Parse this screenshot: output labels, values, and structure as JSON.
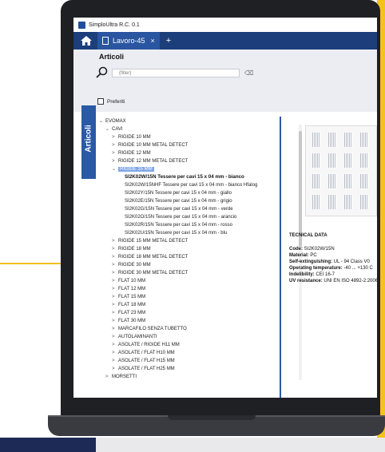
{
  "window": {
    "title": "SimploUltra R.C. 0.1"
  },
  "tabs": {
    "items": [
      {
        "label": "Lavoro-45"
      }
    ],
    "add_label": "+",
    "close_label": "×"
  },
  "panel": {
    "title": "Articoli",
    "search_placeholder": "(filter)",
    "favorites_label": "Preferiti",
    "side_tab_label": "Articoli"
  },
  "tree": [
    {
      "label": "EVOMAX",
      "caret": "⌄",
      "indent": 0,
      "style": "normal"
    },
    {
      "label": "CAVI",
      "caret": "⌄",
      "indent": 1,
      "style": "normal"
    },
    {
      "label": "RIGIDE 10 MM",
      "caret": ">",
      "indent": 2,
      "style": "normal"
    },
    {
      "label": "RIGIDE 10 MM METAL DETECT",
      "caret": ">",
      "indent": 2,
      "style": "normal"
    },
    {
      "label": "RIGIDE 12 MM",
      "caret": ">",
      "indent": 2,
      "style": "normal"
    },
    {
      "label": "RIGIDE 12 MM METAL DETECT",
      "caret": ">",
      "indent": 2,
      "style": "normal"
    },
    {
      "label": "RIGIDE 15 MM",
      "caret": "⌄",
      "indent": 2,
      "style": "selected"
    },
    {
      "label": "SI2K02W/15N   Tessere per cavi 15 x 04 mm - bianco",
      "caret": "",
      "indent": 3,
      "style": "bold"
    },
    {
      "label": "SI2K02W/15NHF   Tessere per cavi 15 x 04 mm - bianco Hfalog",
      "caret": "",
      "indent": 3,
      "style": "normal"
    },
    {
      "label": "SI2K02Y/15N   Tessere per cavi 15 x 04 mm - giallo",
      "caret": "",
      "indent": 3,
      "style": "normal"
    },
    {
      "label": "SI2K02E/15N   Tessere per cavi 15 x 04 mm - grigio",
      "caret": "",
      "indent": 3,
      "style": "normal"
    },
    {
      "label": "SI2K02G/15N   Tessere per cavi 15 x 04 mm - verde",
      "caret": "",
      "indent": 3,
      "style": "normal"
    },
    {
      "label": "SI2K02O/15N   Tessere per cavi 15 x 04 mm - arancio",
      "caret": "",
      "indent": 3,
      "style": "normal"
    },
    {
      "label": "SI2K02R/15N   Tessere per cavi 15 x 04 mm - rosso",
      "caret": "",
      "indent": 3,
      "style": "normal"
    },
    {
      "label": "SI2K02U/15N   Tessere per cavi 15 x 04 mm - blu",
      "caret": "",
      "indent": 3,
      "style": "normal"
    },
    {
      "label": "RIGIDE 15 MM METAL DETECT",
      "caret": ">",
      "indent": 2,
      "style": "normal"
    },
    {
      "label": "RIGIDE 18 MM",
      "caret": ">",
      "indent": 2,
      "style": "normal"
    },
    {
      "label": "RIGIDE 18 MM METAL DETECT",
      "caret": ">",
      "indent": 2,
      "style": "normal"
    },
    {
      "label": "RIGIDE 30 MM",
      "caret": ">",
      "indent": 2,
      "style": "normal"
    },
    {
      "label": "RIGIDE 30 MM METAL DETECT",
      "caret": ">",
      "indent": 2,
      "style": "normal"
    },
    {
      "label": "FLAT 10 MM",
      "caret": ">",
      "indent": 2,
      "style": "normal"
    },
    {
      "label": "FLAT 12 MM",
      "caret": ">",
      "indent": 2,
      "style": "normal"
    },
    {
      "label": "FLAT 15 MM",
      "caret": ">",
      "indent": 2,
      "style": "normal"
    },
    {
      "label": "FLAT 18 MM",
      "caret": ">",
      "indent": 2,
      "style": "normal"
    },
    {
      "label": "FLAT 23 MM",
      "caret": ">",
      "indent": 2,
      "style": "normal"
    },
    {
      "label": "FLAT 30 MM",
      "caret": ">",
      "indent": 2,
      "style": "normal"
    },
    {
      "label": "MARCAFILO SENZA TUBETTO",
      "caret": ">",
      "indent": 2,
      "style": "normal"
    },
    {
      "label": "AUTOLAMINANTI",
      "caret": ">",
      "indent": 2,
      "style": "normal"
    },
    {
      "label": "ASOLATE / RIGIDE H11 MM",
      "caret": ">",
      "indent": 2,
      "style": "normal"
    },
    {
      "label": "ASOLATE / FLAT H10 MM",
      "caret": ">",
      "indent": 2,
      "style": "normal"
    },
    {
      "label": "ASOLATE / FLAT H15 MM",
      "caret": ">",
      "indent": 2,
      "style": "normal"
    },
    {
      "label": "ASOLATE / FLAT H25 MM",
      "caret": ">",
      "indent": 2,
      "style": "normal"
    },
    {
      "label": "MORSETTI",
      "caret": ">",
      "indent": 1,
      "style": "normal"
    }
  ],
  "technical": {
    "heading": "TECNICAL DATA",
    "lines": [
      {
        "key": "Code:",
        "value": "SI2K02W/15N"
      },
      {
        "key": "Material:",
        "value": "PC"
      },
      {
        "key": "Self-extinguishing:",
        "value": "UL - 94 Class V0"
      },
      {
        "key": "Operating temperature:",
        "value": "-40 ... +130 C"
      },
      {
        "key": "Indelibility:",
        "value": "CEI 16-7"
      },
      {
        "key": "UV resistance:",
        "value": "UNI EN ISO 4892-2:2006"
      }
    ]
  },
  "colors": {
    "brand_blue": "#1c3e7a",
    "accent_yellow": "#f4c21c",
    "selection": "#7fa6e6"
  }
}
